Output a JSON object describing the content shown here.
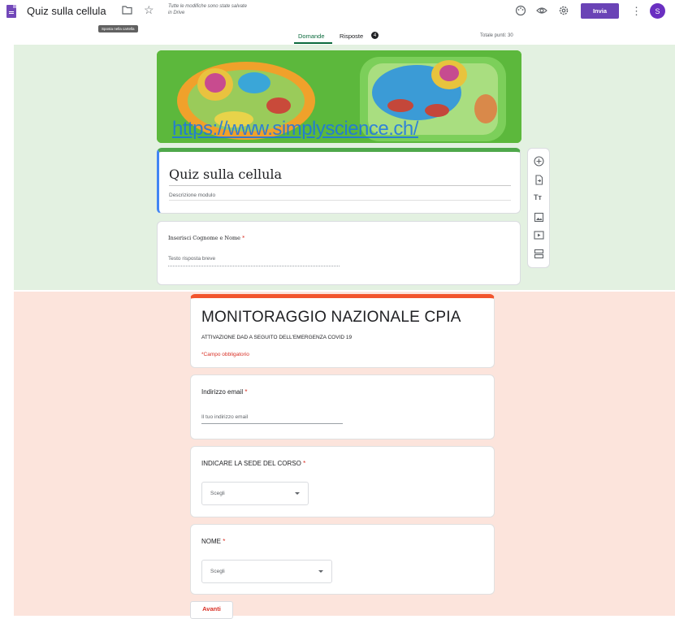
{
  "header": {
    "title": "Quiz sulla cellula",
    "saved_note": "Tutte le modifiche sono state salvate in Drive",
    "tooltip": "Sposta nella cartella",
    "send_label": "Invia",
    "avatar_letter": "S",
    "icons": [
      "forms-doc-icon",
      "folder-icon",
      "star-icon",
      "palette-icon",
      "eye-icon",
      "settings-icon",
      "more-vert-icon"
    ]
  },
  "tabs": {
    "questions": "Domande",
    "responses": "Risposte",
    "responses_count": "4",
    "total_points": "Totale punti: 30"
  },
  "editor": {
    "banner_url": "https://www.simplyscience.ch/",
    "form_title": "Quiz sulla cellula",
    "form_description": "Descrizione modulo",
    "question_label": "Inserisci Cognome e Nome",
    "question_required": "*",
    "answer_placeholder": "Testo risposta breve",
    "toolbar_icons": [
      "add-question-icon",
      "import-questions-icon",
      "add-title-icon",
      "add-image-icon",
      "add-video-icon",
      "add-section-icon"
    ]
  },
  "preview": {
    "title": "MONITORAGGIO NAZIONALE CPIA",
    "subtitle": "ATTIVAZIONE DAD A SEGUITO DELL'EMERGENZA COVID 19",
    "required_note": "*Campo obbligatorio",
    "email_label": "Indirizzo email",
    "email_placeholder": "Il tuo indirizzo email",
    "sede_label": "INDICARE LA SEDE DEL CORSO",
    "sede_select": "Scegli",
    "nome_label": "NOME",
    "nome_select": "Scegli",
    "required_mark": "*",
    "next_label": "Avanti"
  },
  "colors": {
    "accent": "#6a43b6",
    "green_bg": "#e3f1e1",
    "pink_bg": "#fce4dc",
    "preview_accent": "#f2542d",
    "required": "#d93025"
  }
}
